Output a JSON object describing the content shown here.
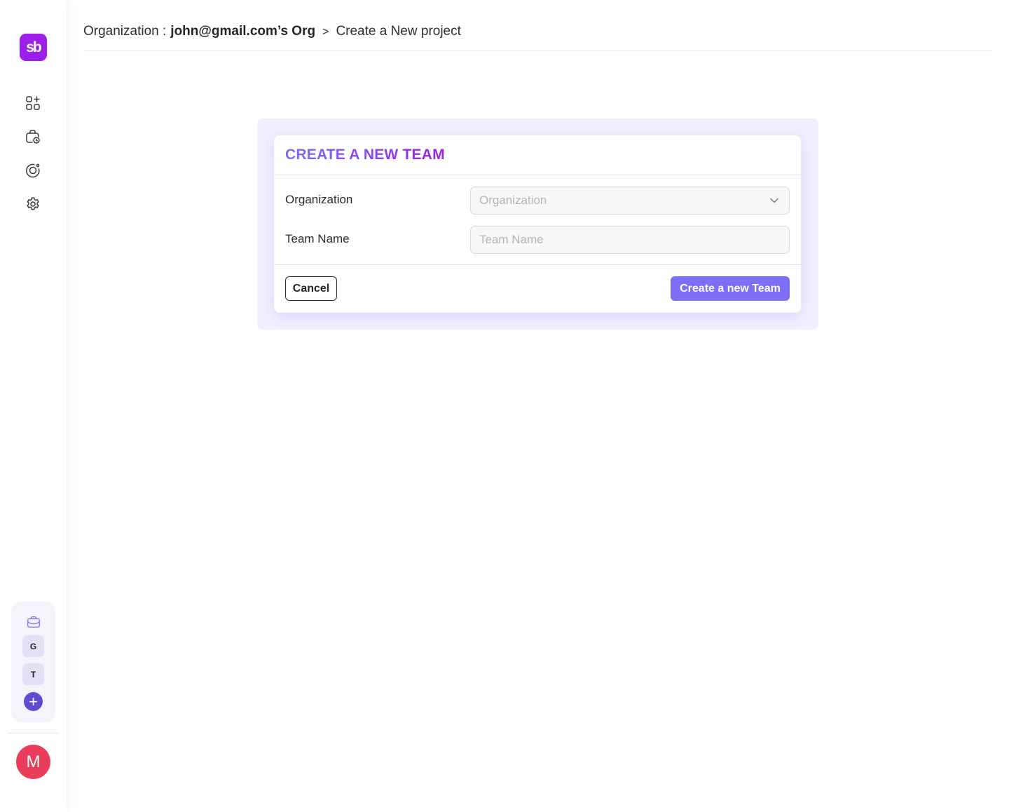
{
  "sidebar": {
    "logo_text": "sb",
    "nav": [
      {
        "icon": "grid-add-icon"
      },
      {
        "icon": "briefcase-clock-icon"
      },
      {
        "icon": "target-icon"
      },
      {
        "icon": "gear-icon"
      }
    ],
    "teams": {
      "header_icon": "briefcase-icon",
      "items": [
        {
          "initial": "G"
        },
        {
          "initial": "T"
        }
      ],
      "add_label": "+"
    },
    "avatar_initial": "M"
  },
  "breadcrumb": {
    "prefix": "Organization :",
    "org_name": "john@gmail.com’s Org",
    "separator": ">",
    "current": "Create a New project"
  },
  "modal": {
    "title": "CREATE A NEW TEAM",
    "fields": {
      "organization": {
        "label": "Organization",
        "placeholder": "Organization",
        "value": ""
      },
      "team_name": {
        "label": "Team Name",
        "placeholder": "Team Name",
        "value": ""
      }
    },
    "cancel_label": "Cancel",
    "submit_label": "Create a new Team"
  },
  "colors": {
    "brand": "#9b1fe8",
    "accent": "#7c6ef5",
    "avatar": "#ea3d5b",
    "add_button": "#5f4bd0"
  }
}
